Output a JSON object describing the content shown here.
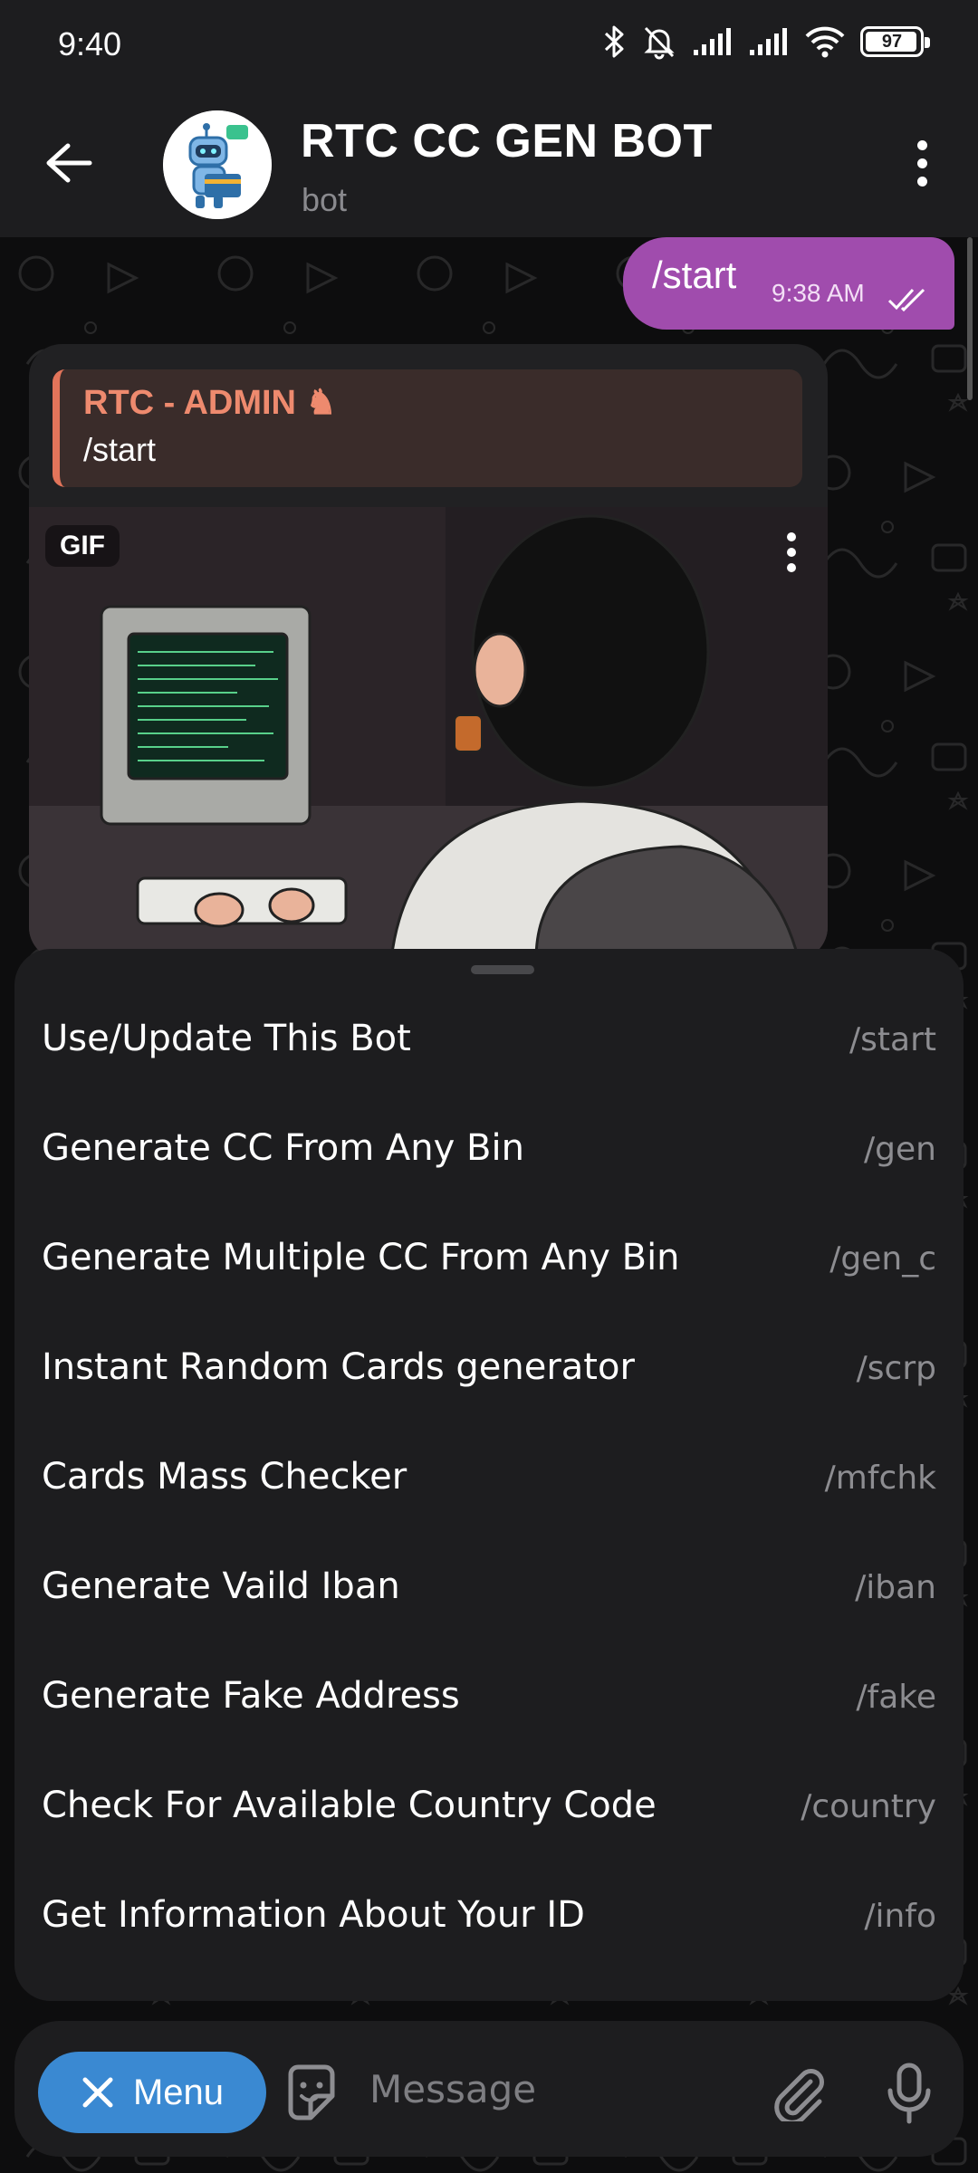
{
  "status_bar": {
    "time": "9:40",
    "battery": "97",
    "battery_level": 0.97
  },
  "header": {
    "title": "RTC CC GEN BOT",
    "subtitle": "bot"
  },
  "messages": {
    "outgoing": {
      "text": "/start",
      "time": "9:38 AM"
    },
    "incoming": {
      "reply_name": "RTC - ADMIN ♞",
      "reply_text": "/start",
      "media_badge": "GIF"
    }
  },
  "commands": [
    {
      "label": "Use/Update This Bot",
      "command": "/start"
    },
    {
      "label": "Generate CC From Any Bin",
      "command": "/gen"
    },
    {
      "label": "Generate Multiple CC From Any Bin",
      "command": "/gen_c"
    },
    {
      "label": "Instant Random Cards generator",
      "command": "/scrp"
    },
    {
      "label": "Cards Mass Checker",
      "command": "/mfchk"
    },
    {
      "label": "Generate Vaild Iban",
      "command": "/iban"
    },
    {
      "label": "Generate Fake Address",
      "command": "/fake"
    },
    {
      "label": "Check For Available Country Code",
      "command": "/country"
    },
    {
      "label": "Get Information About Your ID",
      "command": "/info"
    }
  ],
  "input_bar": {
    "menu_label": "Menu",
    "placeholder": "Message"
  },
  "colors": {
    "outgoing_bubble": "#a04cad",
    "reply_accent": "#e2745a",
    "menu_button": "#3a89d2",
    "surface": "#1d1d1f"
  }
}
